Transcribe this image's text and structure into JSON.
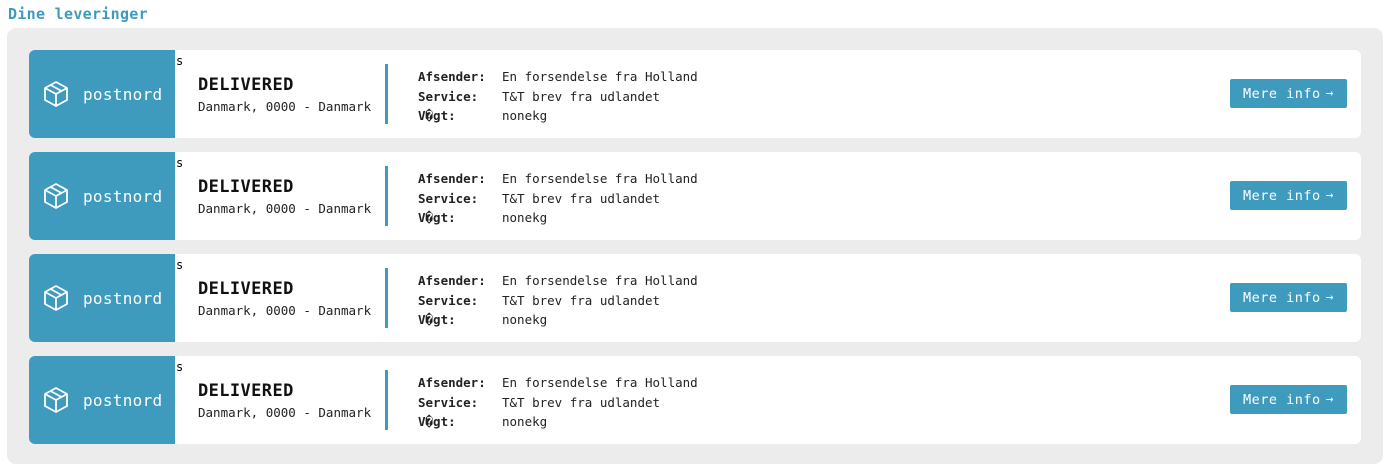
{
  "header": {
    "title": "Dine leveringer"
  },
  "deliveries": [
    {
      "carrier": "postnord",
      "marker": "s",
      "status": "DELIVERED",
      "location": "Danmark, 0000 - Danmark",
      "sender_label": "Afsender:",
      "sender_value": "En forsendelse fra Holland",
      "service_label": "Service:",
      "service_value": "T&T brev fra udlandet",
      "weight_label": "V�gt:",
      "weight_value": "nonekg",
      "button_label": "Mere info",
      "button_arrow": "→"
    },
    {
      "carrier": "postnord",
      "marker": "s",
      "status": "DELIVERED",
      "location": "Danmark, 0000 - Danmark",
      "sender_label": "Afsender:",
      "sender_value": "En forsendelse fra Holland",
      "service_label": "Service:",
      "service_value": "T&T brev fra udlandet",
      "weight_label": "V�gt:",
      "weight_value": "nonekg",
      "button_label": "Mere info",
      "button_arrow": "→"
    },
    {
      "carrier": "postnord",
      "marker": "s",
      "status": "DELIVERED",
      "location": "Danmark, 0000 - Danmark",
      "sender_label": "Afsender:",
      "sender_value": "En forsendelse fra Holland",
      "service_label": "Service:",
      "service_value": "T&T brev fra udlandet",
      "weight_label": "V�gt:",
      "weight_value": "nonekg",
      "button_label": "Mere info",
      "button_arrow": "→"
    },
    {
      "carrier": "postnord",
      "marker": "s",
      "status": "DELIVERED",
      "location": "Danmark, 0000 - Danmark",
      "sender_label": "Afsender:",
      "sender_value": "En forsendelse fra Holland",
      "service_label": "Service:",
      "service_value": "T&T brev fra udlandet",
      "weight_label": "V�gt:",
      "weight_value": "nonekg",
      "button_label": "Mere info",
      "button_arrow": "→"
    }
  ],
  "icons": {
    "carrier_icon": "package-box-icon",
    "button_icon": "arrow-right-icon"
  },
  "colors": {
    "accent": "#3e9bbd",
    "panel_background": "#ececec",
    "card_background": "#ffffff"
  }
}
